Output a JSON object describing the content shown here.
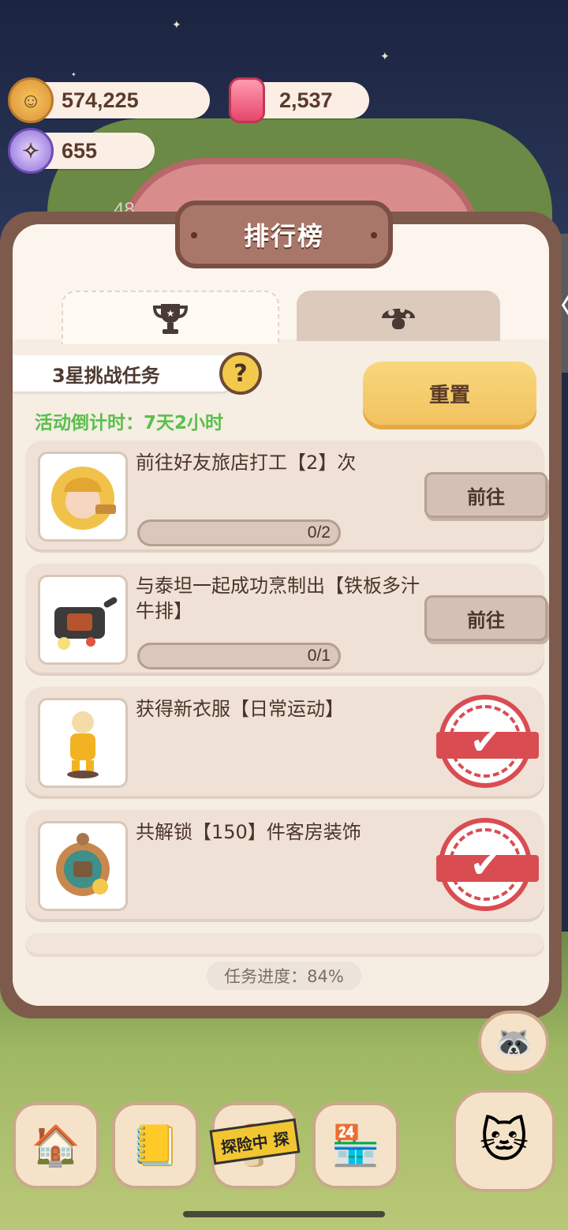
{
  "currencies": {
    "cookies": "574,225",
    "candles": "2,537",
    "gems": "655"
  },
  "hud": {
    "level_partial": "48"
  },
  "panel": {
    "title": "排行榜",
    "tabs": [
      {
        "icon": "trophy-icon",
        "active": true
      },
      {
        "icon": "mushroom-icon",
        "active": false
      }
    ],
    "task_header": "3星挑战任务",
    "help_symbol": "?",
    "reset_label": "重置",
    "countdown": "活动倒计时：7天2小时",
    "tasks": [
      {
        "text": "前往好友旅店打工【2】次",
        "progress": "0/2",
        "action": "前往",
        "completed": false,
        "thumb": "worker-icon"
      },
      {
        "text": "与泰坦一起成功烹制出【铁板多汁牛排】",
        "progress": "0/1",
        "action": "前往",
        "completed": false,
        "thumb": "steak-icon"
      },
      {
        "text": "获得新衣服【日常运动】",
        "progress": "",
        "action": "",
        "completed": true,
        "thumb": "outfit-icon"
      },
      {
        "text": "共解锁【150】件客房装饰",
        "progress": "",
        "action": "",
        "completed": true,
        "thumb": "decor-icon"
      }
    ],
    "overall_progress": "任务进度：84%"
  },
  "bottom_nav": {
    "explore_tag": "探险中 探"
  },
  "colors": {
    "accent_green": "#5abf4c",
    "reset_yellow": "#f1c35f",
    "stamp_red": "#d94d52",
    "panel_frame": "#7d5a4b"
  }
}
